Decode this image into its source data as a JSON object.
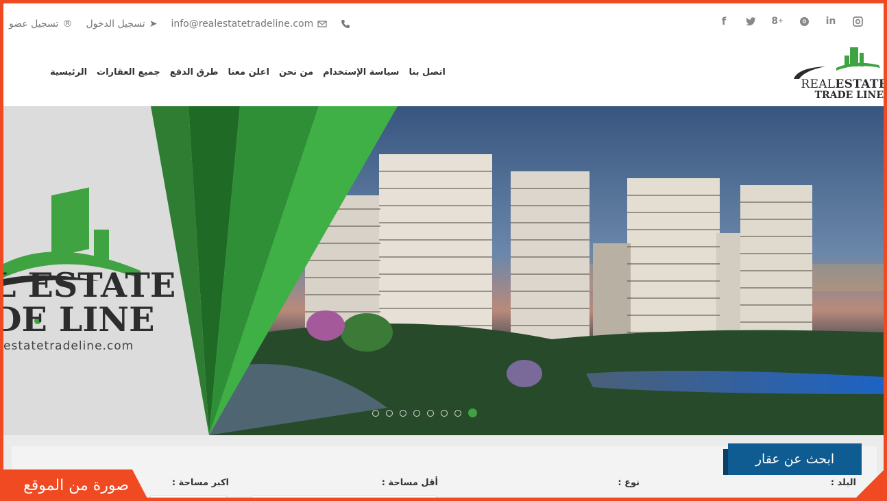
{
  "topbar": {
    "register": "تسجيل عضو",
    "login": "تسجيل الدخول",
    "email": "info@realestatetradeline.com",
    "socials": [
      "facebook-icon",
      "twitter-icon",
      "google-plus-icon",
      "pinterest-icon",
      "linkedin-icon",
      "instagram-icon"
    ]
  },
  "nav": {
    "items": [
      "الرئيسية",
      "جميع العقارات",
      "طرق الدفع",
      "اعلن معنا",
      "من نحن",
      "سياسة الإستخدام",
      "اتصل بنا"
    ]
  },
  "logo": {
    "line1_a": "REAL",
    "line1_b": "ESTATE",
    "line2": "TRADE LINE"
  },
  "hero": {
    "brand_line1": "L ESTATE",
    "brand_line2": "DE LINE",
    "brand_url": "estatetradeline.com",
    "slides_count": 8,
    "active_slide": 8
  },
  "search": {
    "title": "ابحث عن عقار",
    "country_label": "البلد :",
    "type_label": "نوع :",
    "min_area_label": "أقل مساحة :",
    "max_area_label": "اكبر مساحة :"
  },
  "watermark": "صورة من الموقع",
  "colors": {
    "accent": "#f04a23",
    "brand_green": "#3fa342",
    "search_blue": "#0e5c91"
  }
}
